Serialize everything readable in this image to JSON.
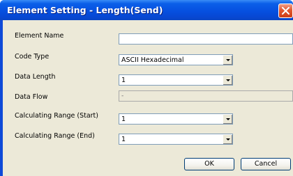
{
  "window": {
    "title": "Element Setting - Length(Send)",
    "close_icon": "close-icon"
  },
  "form": {
    "element_name": {
      "label": "Element Name",
      "value": ""
    },
    "code_type": {
      "label": "Code Type",
      "value": "ASCII Hexadecimal"
    },
    "data_length": {
      "label": "Data Length",
      "value": "1"
    },
    "data_flow": {
      "label": "Data Flow",
      "value": "-"
    },
    "calc_range_start": {
      "label": "Calculating Range (Start)",
      "value": "1"
    },
    "calc_range_end": {
      "label": "Calculating Range (End)",
      "value": "1"
    }
  },
  "buttons": {
    "ok": "OK",
    "cancel": "Cancel"
  },
  "colors": {
    "titlebar": "#0650e0",
    "client_bg": "#ece9d8",
    "close_button": "#e2572f",
    "field_border": "#7f9db9"
  }
}
